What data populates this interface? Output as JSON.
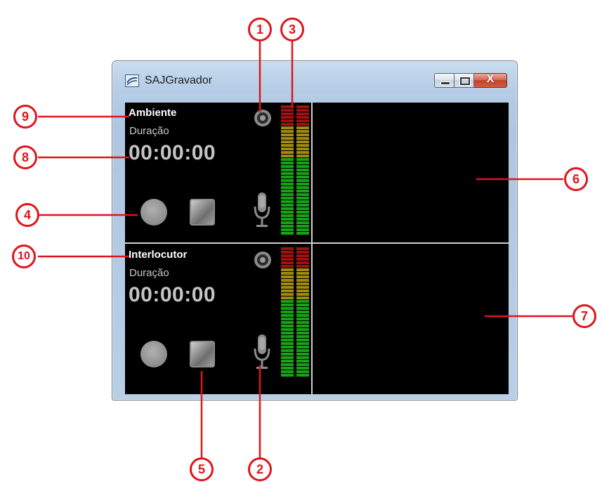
{
  "window": {
    "title": "SAJGravador",
    "close_symbol": "X"
  },
  "channels": [
    {
      "name": "Ambiente",
      "duration_label": "Duração",
      "time": "00:00:00"
    },
    {
      "name": "Interlocutor",
      "duration_label": "Duração",
      "time": "00:00:00"
    }
  ],
  "callouts": {
    "c1": "1",
    "c2": "2",
    "c3": "3",
    "c4": "4",
    "c5": "5",
    "c6": "6",
    "c7": "7",
    "c8": "8",
    "c9": "9",
    "c10": "10"
  },
  "colors": {
    "callout": "#e0141a",
    "vu_red": "#a01010",
    "vu_yellow": "#a08a10",
    "vu_green": "#18a018"
  },
  "icons": {
    "source": "speaker-ring-icon",
    "record": "record-circle-icon",
    "stop": "stop-square-icon",
    "mic": "microphone-icon",
    "app": "sajgravador-app-icon"
  }
}
